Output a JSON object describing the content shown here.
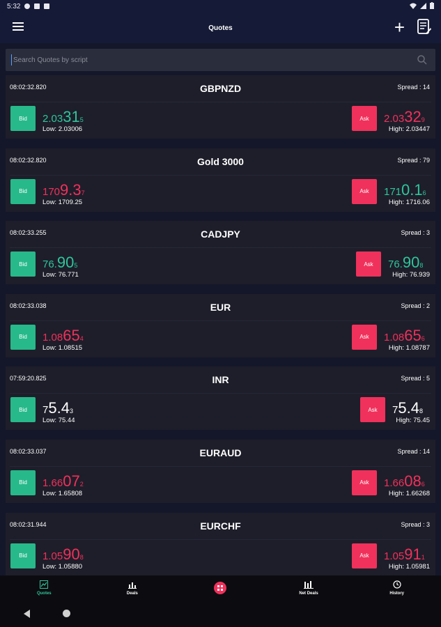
{
  "status_bar": {
    "time": "5:32"
  },
  "header": {
    "title": "Quotes"
  },
  "search": {
    "placeholder": "Search Quotes by script"
  },
  "labels": {
    "bid": "Bid",
    "ask": "Ask",
    "low_prefix": "Low: ",
    "high_prefix": "High: ",
    "spread_prefix": "Spread : "
  },
  "quotes": [
    {
      "time": "08:02:32.820",
      "symbol": "GBPNZD",
      "spread": "14",
      "bid": {
        "small": "2.03",
        "big": "31",
        "sup": "5",
        "color": "green"
      },
      "ask": {
        "small": "2.03",
        "big": "32",
        "sup": "9",
        "color": "red"
      },
      "low": "2.03006",
      "high": "2.03447"
    },
    {
      "time": "08:02:32.820",
      "symbol": "Gold 3000",
      "spread": "79",
      "bid": {
        "small": "170",
        "big": "9.3",
        "sup": "7",
        "color": "red"
      },
      "ask": {
        "small": "171",
        "big": "0.1",
        "sup": "6",
        "color": "green"
      },
      "low": "1709.25",
      "high": "1716.06"
    },
    {
      "time": "08:02:33.255",
      "symbol": "CADJPY",
      "spread": "3",
      "bid": {
        "small": "76.",
        "big": "90",
        "sup": "5",
        "color": "green"
      },
      "ask": {
        "small": "76.",
        "big": "90",
        "sup": "8",
        "color": "green"
      },
      "low": "76.771",
      "high": "76.939"
    },
    {
      "time": "08:02:33.038",
      "symbol": "EUR",
      "spread": "2",
      "bid": {
        "small": "1.08",
        "big": "65",
        "sup": "4",
        "color": "red"
      },
      "ask": {
        "small": "1.08",
        "big": "65",
        "sup": "6",
        "color": "red"
      },
      "low": "1.08515",
      "high": "1.08787"
    },
    {
      "time": "07:59:20.825",
      "symbol": "INR",
      "spread": "5",
      "bid": {
        "small": "7",
        "big": "5.4",
        "sup": "3",
        "color": "white"
      },
      "ask": {
        "small": "7",
        "big": "5.4",
        "sup": "8",
        "color": "white"
      },
      "low": "75.44",
      "high": "75.45"
    },
    {
      "time": "08:02:33.037",
      "symbol": "EURAUD",
      "spread": "14",
      "bid": {
        "small": "1.66",
        "big": "07",
        "sup": "2",
        "color": "red"
      },
      "ask": {
        "small": "1.66",
        "big": "08",
        "sup": "6",
        "color": "red"
      },
      "low": "1.65808",
      "high": "1.66268"
    },
    {
      "time": "08:02:31.944",
      "symbol": "EURCHF",
      "spread": "3",
      "bid": {
        "small": "1.05",
        "big": "90",
        "sup": "8",
        "color": "red"
      },
      "ask": {
        "small": "1.05",
        "big": "91",
        "sup": "1",
        "color": "red"
      },
      "low": "1.05880",
      "high": "1.05981"
    }
  ],
  "bottom_nav": [
    {
      "label": "Quotes",
      "icon": "chart-icon",
      "active": true
    },
    {
      "label": "Deals",
      "icon": "deals-icon",
      "active": false
    },
    {
      "label": "",
      "icon": "center-fab-icon",
      "active": false
    },
    {
      "label": "Net Deals",
      "icon": "net-deals-icon",
      "active": false
    },
    {
      "label": "History",
      "icon": "history-icon",
      "active": false
    }
  ],
  "colors": {
    "green": "#2fc59b",
    "red": "#f0315b",
    "bid_button": "#27b98a",
    "ask_button": "#f0315b",
    "card": "#1e1e2a",
    "header": "#151a36"
  }
}
